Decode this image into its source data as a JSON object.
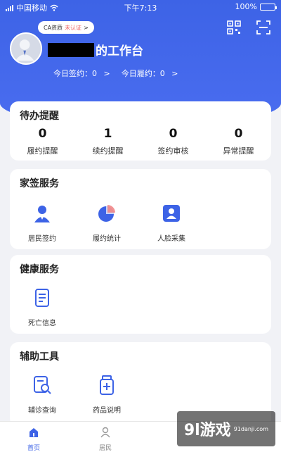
{
  "status_bar": {
    "carrier": "中国移动",
    "time": "下午7:13",
    "battery": "100%"
  },
  "header": {
    "ca_badge": {
      "label": "CA资质",
      "status": "未认证",
      "arrow": ">"
    },
    "title_suffix": "的工作台",
    "stats": [
      {
        "label": "今日签约：0",
        "arrow": ">"
      },
      {
        "label": "今日履约：0",
        "arrow": ">"
      }
    ],
    "icons": [
      "qr-code-icon",
      "scan-icon"
    ]
  },
  "todo_card": {
    "title": "待办提醒",
    "items": [
      {
        "count": "0",
        "label": "履约提醒"
      },
      {
        "count": "1",
        "label": "续约提醒"
      },
      {
        "count": "0",
        "label": "签约审核"
      },
      {
        "count": "0",
        "label": "异常提醒"
      }
    ]
  },
  "family_card": {
    "title": "家签服务",
    "items": [
      {
        "label": "居民签约",
        "icon": "resident-icon"
      },
      {
        "label": "履约统计",
        "icon": "pie-chart-icon"
      },
      {
        "label": "人脸采集",
        "icon": "face-id-icon"
      }
    ]
  },
  "health_card": {
    "title": "健康服务",
    "items": [
      {
        "label": "死亡信息",
        "icon": "document-icon"
      }
    ]
  },
  "tools_card": {
    "title": "辅助工具",
    "items": [
      {
        "label": "辅诊查询",
        "icon": "search-doc-icon"
      },
      {
        "label": "药品说明",
        "icon": "medicine-icon"
      }
    ]
  },
  "tabbar": {
    "tabs": [
      {
        "label": "首页",
        "active": true
      },
      {
        "label": "居民",
        "active": false
      }
    ]
  },
  "watermark": {
    "logo": "9l游戏",
    "url": "91danji.com"
  },
  "colors": {
    "primary": "#3d63e6",
    "background": "#f1f2f6"
  }
}
